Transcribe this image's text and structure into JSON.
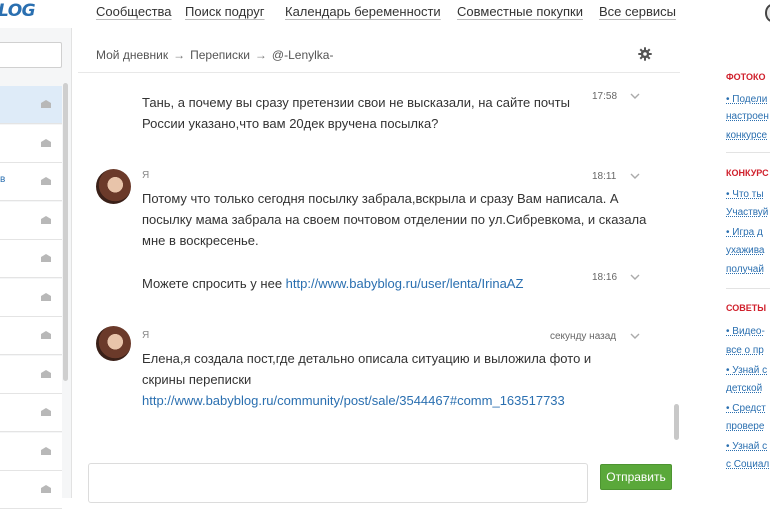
{
  "header": {
    "logo": "LOG",
    "nav": [
      "Сообщества",
      "Поиск подруг",
      "Календарь беременности",
      "Совместные покупки",
      "Все сервисы"
    ]
  },
  "left": {
    "fragment": "в"
  },
  "breadcrumb": {
    "item1": "Мой дневник",
    "item2": "Переписки",
    "item3": "@-Lenylka-",
    "separator": "→"
  },
  "messages": [
    {
      "text": "Тань, а почему вы сразу претензии свои не высказали, на сайте почты России указано,что вам 20дек вручена посылка?",
      "time": "17:58"
    },
    {
      "author": "Я",
      "text": "Потому что только сегодня посылку забрала,вскрыла и сразу Вам написала. А посылку мама забрала на своем почтовом отделении по ул.Сибревкома, и сказала мне в воскресенье.",
      "time": "18:11"
    },
    {
      "text_prefix": "Можете спросить у нее ",
      "link": "http://www.babyblog.ru/user/lenta/IrinaAZ",
      "time": "18:16"
    },
    {
      "author": "Я",
      "text": "Елена,я создала пост,где детально описала ситуацию и выложила фото и скрины переписки",
      "link": "http://www.babyblog.ru/community/post/sale/3544467#comm_163517733",
      "time": "секунду назад"
    }
  ],
  "composer": {
    "send_label": "Отправить"
  },
  "right": {
    "sections": [
      {
        "title": "ФОТОКО",
        "links": [
          "• Подели",
          "настроен",
          "конкурсе"
        ]
      },
      {
        "title": "КОНКУРС",
        "links": [
          "• Что ты",
          "Участвуй",
          "• Игра д",
          "ухажива",
          "получай"
        ]
      },
      {
        "title": "СОВЕТЫ",
        "links": [
          "• Видео-",
          "все о пр",
          "• Узнай с",
          "детской",
          "• Средст",
          "провере",
          "• Узнай с",
          "с Социал"
        ]
      }
    ]
  },
  "colors": {
    "accent": "#2a6fb0",
    "send_button": "#5aa83a",
    "right_title": "#d0202c",
    "active_row": "#deebf8"
  }
}
